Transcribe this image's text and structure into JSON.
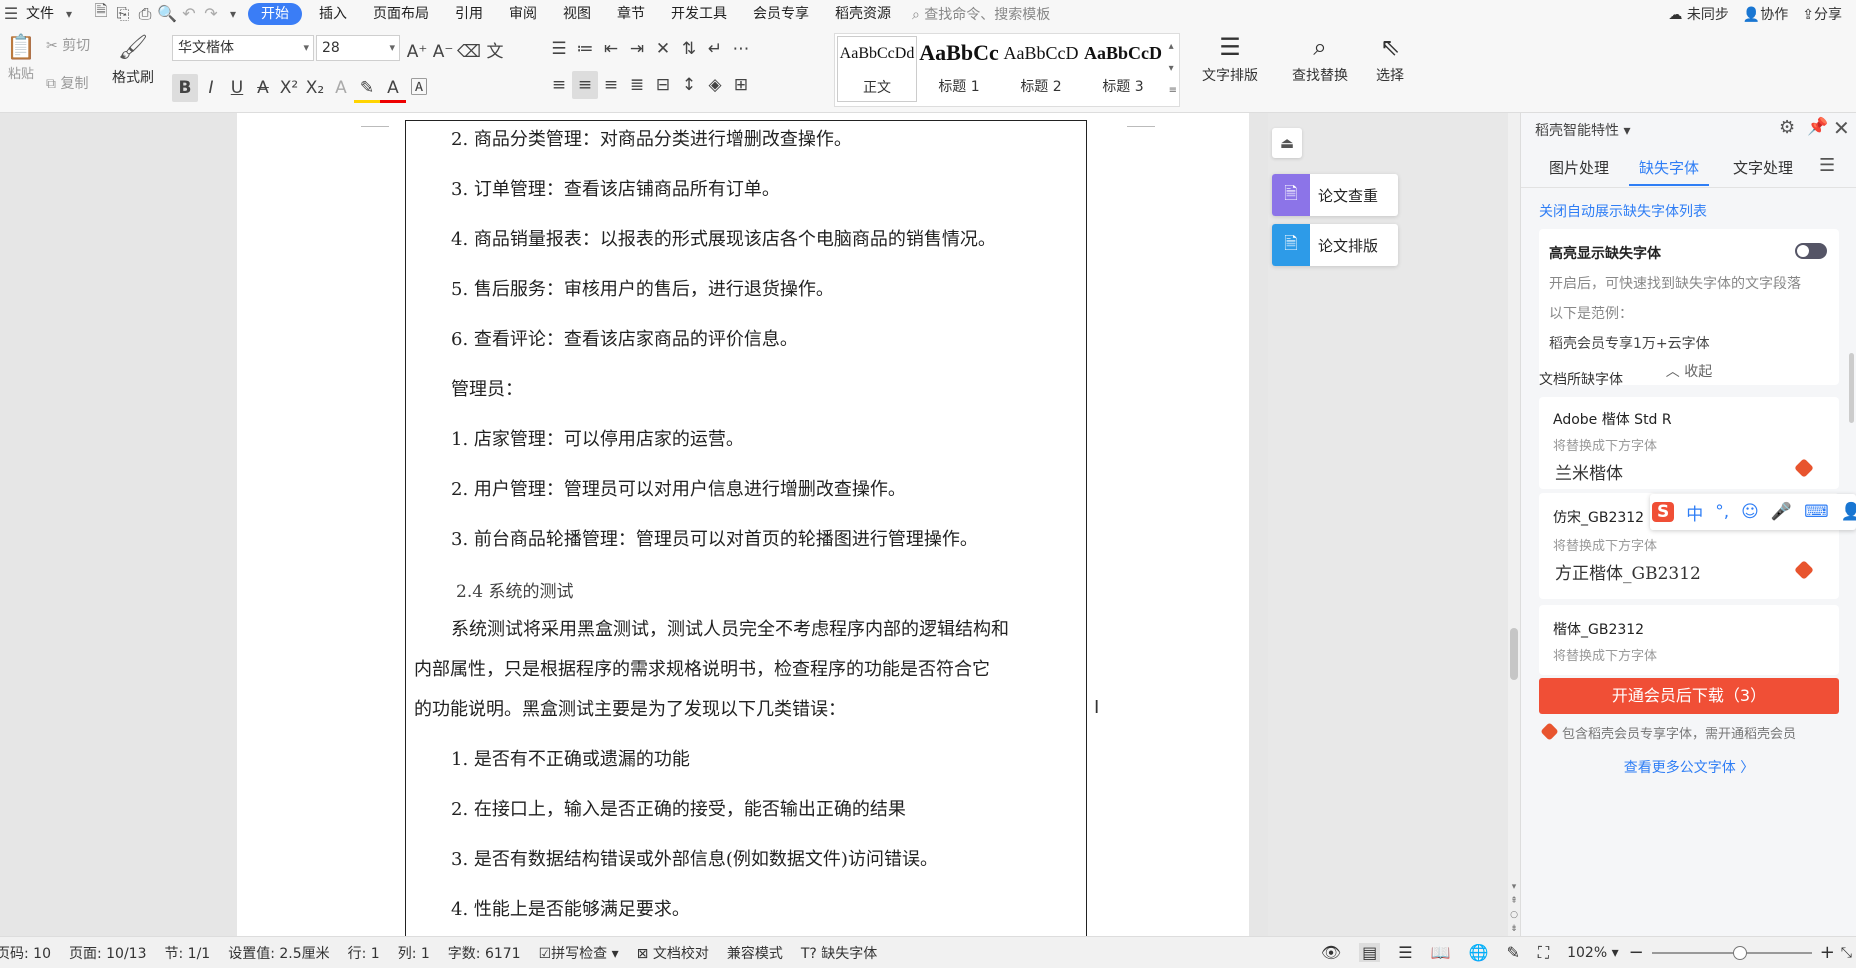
{
  "menubar": {
    "file_label": "文件",
    "tabs": [
      "开始",
      "插入",
      "页面布局",
      "引用",
      "审阅",
      "视图",
      "章节",
      "开发工具",
      "会员专享",
      "稻壳资源"
    ],
    "active_tab": "开始",
    "search_placeholder": "查找命令、搜索模板",
    "sync_label": "未同步",
    "collab_label": "协作",
    "share_label": "分享"
  },
  "ribbon": {
    "paste_label": "粘贴",
    "cut_label": "剪切",
    "copy_label": "复制",
    "format_painter_label": "格式刷",
    "font_name": "华文楷体",
    "font_size": "28",
    "styles": [
      {
        "preview": "AaBbCcDd",
        "label": "正文"
      },
      {
        "preview": "AaBbCc",
        "label": "标题 1"
      },
      {
        "preview": "AaBbCcD",
        "label": "标题 2"
      },
      {
        "preview": "AaBbCcD",
        "label": "标题 3"
      }
    ],
    "text_layout_label": "文字排版",
    "find_replace_label": "查找替换",
    "select_label": "选择"
  },
  "document": {
    "lines": [
      "2. 商品分类管理：对商品分类进行增删改查操作。",
      "3. 订单管理：查看该店铺商品所有订单。",
      "4. 商品销量报表：以报表的形式展现该店各个电脑商品的销售情况。",
      "5. 售后服务：审核用户的售后，进行退货操作。",
      "6. 查看评论：查看该店家商品的评价信息。",
      "管理员：",
      "1. 店家管理：可以停用店家的运营。",
      "2. 用户管理：管理员可以对用户信息进行增删改查操作。",
      "3. 前台商品轮播管理：管理员可以对首页的轮播图进行管理操作。"
    ],
    "section_heading": "2.4 系统的测试",
    "paragraph": [
      "系统测试将采用黑盒测试，测试人员完全不考虑程序内部的逻辑结构和",
      "内部属性，只是根据程序的需求规格说明书，检查程序的功能是否符合它",
      "的功能说明。黑盒测试主要是为了发现以下几类错误："
    ],
    "list": [
      "1. 是否有不正确或遗漏的功能",
      "2. 在接口上，输入是否正确的接受，能否输出正确的结果",
      "3. 是否有数据结构错误或外部信息(例如数据文件)访问错误。",
      "4. 性能上是否能够满足要求。"
    ]
  },
  "float_tools": {
    "check_label": "论文查重",
    "layout_label": "论文排版"
  },
  "sidebar": {
    "title": "稻壳智能特性",
    "tabs": [
      "图片处理",
      "缺失字体",
      "文字处理"
    ],
    "active_tab": "缺失字体",
    "close_auto_link": "关闭自动展示缺失字体列表",
    "highlight_title": "高亮显示缺失字体",
    "highlight_desc": "开启后，可快速找到缺失字体的文字段落",
    "example_label": "以下是范例：",
    "example_text": "稻壳会员专享1万+云字体",
    "collapse_label": "收起",
    "missing_heading": "文档所缺字体",
    "fonts": [
      {
        "name": "Adobe 楷体 Std R",
        "replace_label": "将替换成下方字体",
        "replacement": "兰米楷体"
      },
      {
        "name": "仿宋_GB2312",
        "replace_label": "将替换成下方字体",
        "replacement": "方正楷体_GB2312"
      },
      {
        "name": "楷体_GB2312",
        "replace_label": "将替换成下方字体",
        "replacement": ""
      }
    ],
    "download_button": "开通会员后下载（3）",
    "member_note": "包含稻壳会员专享字体，需开通稻壳会员",
    "more_link": "查看更多公文字体 〉"
  },
  "ime": {
    "items": [
      "中",
      "°,",
      "☺",
      "🎤",
      "⌨",
      "👤"
    ]
  },
  "statusbar": {
    "page_code": "页码: 10",
    "page": "页面: 10/13",
    "section": "节: 1/1",
    "setting": "设置值: 2.5厘米",
    "row": "行: 1",
    "col": "列: 1",
    "word_count": "字数: 6171",
    "spell_check": "拼写检查",
    "doc_proof": "文档校对",
    "compat_mode": "兼容模式",
    "missing_font": "缺失字体",
    "zoom": "102%",
    "zoom_level": 0.55
  },
  "colors": {
    "accent": "#3a7df6",
    "download": "#f04f36",
    "member": "#e8542e"
  }
}
